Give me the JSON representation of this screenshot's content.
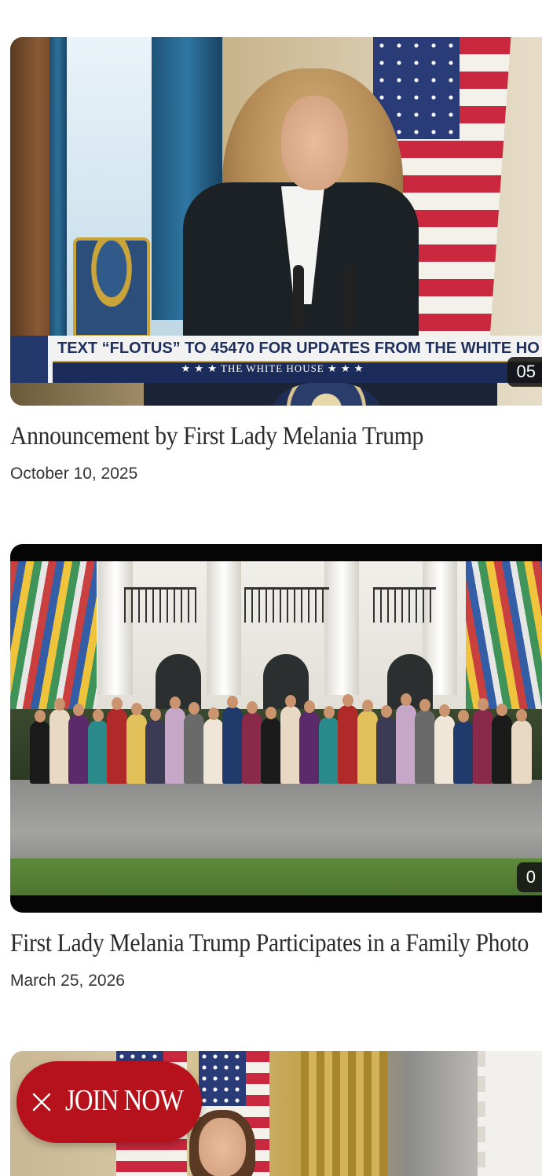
{
  "feed": {
    "videos": [
      {
        "title": "Announcement by First Lady Melania Trump",
        "date": "October 10, 2025",
        "duration_visible": "05",
        "lower_third": "TEXT “FLOTUS” TO 45470 FOR UPDATES FROM THE WHITE HO",
        "banner": "★ ★ ★   THE WHITE HOUSE   ★ ★ ★"
      },
      {
        "title": "First Lady Melania Trump Participates in a Family Photo",
        "date": "March 25, 2026",
        "duration_visible": "0"
      },
      {
        "title": "",
        "date": ""
      }
    ]
  },
  "join_button": {
    "label": "JOIN NOW",
    "close_icon": "close-icon",
    "color": "#b5121b"
  },
  "colors": {
    "title_text": "#2b2b2b",
    "date_text": "#333333",
    "background": "#ffffff"
  }
}
